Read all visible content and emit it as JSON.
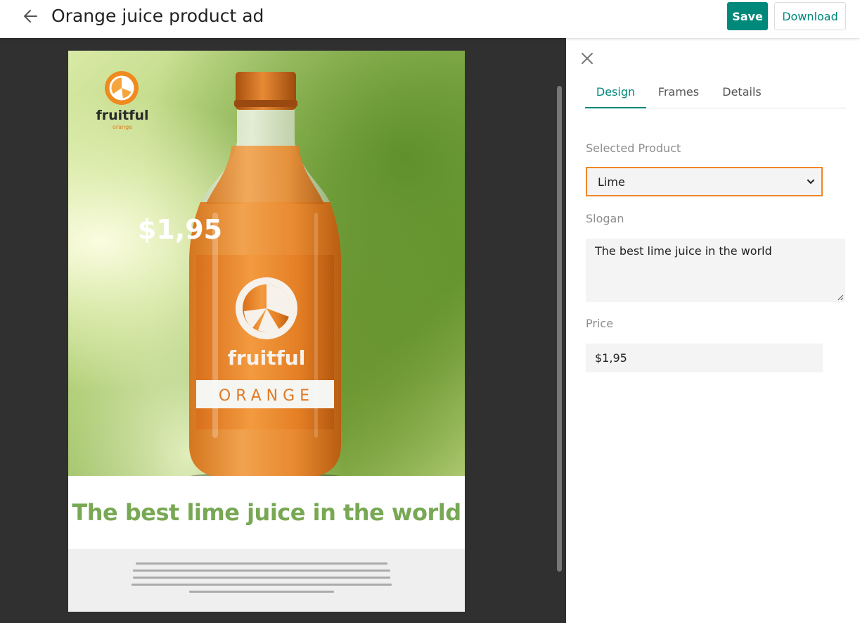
{
  "header": {
    "title": "Orange juice product ad",
    "save_label": "Save",
    "download_label": "Download"
  },
  "ad": {
    "logo_brand": "fruitful",
    "logo_sub": "orange",
    "price_badge": "$1,95",
    "bottle_brand": "fruitful",
    "bottle_flavor": "ORANGE",
    "slogan": "The best lime juice in the world"
  },
  "panel": {
    "tabs": [
      {
        "label": "Design",
        "active": true
      },
      {
        "label": "Frames",
        "active": false
      },
      {
        "label": "Details",
        "active": false
      }
    ],
    "selected_product_label": "Selected Product",
    "selected_product_value": "Lime",
    "slogan_label": "Slogan",
    "slogan_value": "The best lime juice in the world",
    "price_label": "Price",
    "price_value": "$1,95"
  },
  "colors": {
    "accent": "#00897b",
    "focus_border": "#f0862a",
    "slogan_green": "#78a854",
    "badge_red": "#e8413c"
  }
}
